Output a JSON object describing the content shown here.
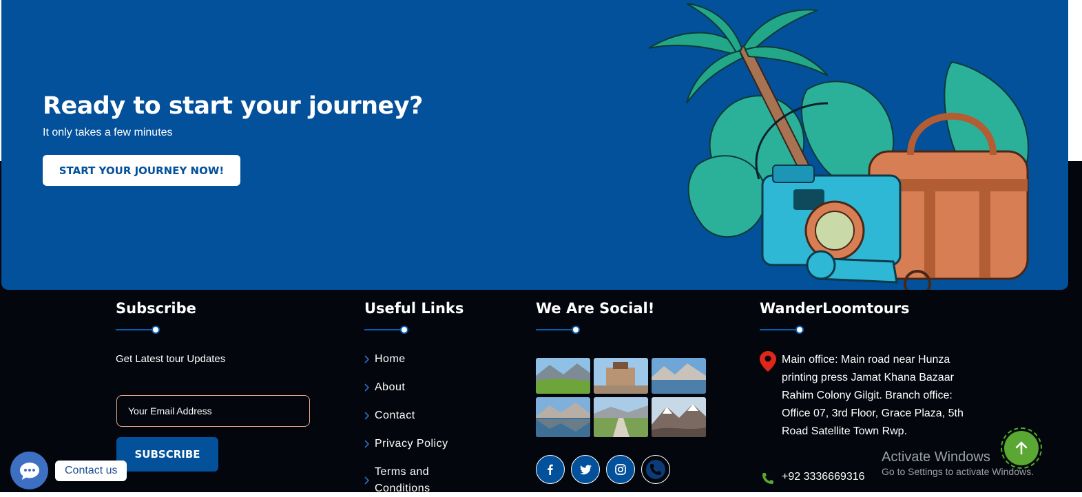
{
  "cta": {
    "title": "Ready to start your journey?",
    "subtitle": "It only takes a few minutes",
    "button": "START YOUR JOURNEY NOW!"
  },
  "subscribe": {
    "heading": "Subscribe",
    "text": "Get Latest tour Updates",
    "email_placeholder": "Your Email Address",
    "button": "SUBSCRIBE"
  },
  "useful_links": {
    "heading": "Useful Links",
    "items": [
      "Home",
      "About",
      "Contact",
      "Privacy Policy",
      "Terms and Conditions"
    ]
  },
  "social": {
    "heading": "We Are Social!",
    "gallery": [
      "valley-meadow-photo",
      "fort-photo",
      "lake-mountains-photo",
      "lake-reflection-photo",
      "road-valley-photo",
      "snowy-mountain-photo"
    ],
    "icons": [
      "facebook-icon",
      "twitter-icon",
      "instagram-icon",
      "phone-icon"
    ]
  },
  "company": {
    "heading": "WanderLoomtours",
    "address": "Main office: Main road near Hunza printing press Jamat Khana Bazaar Rahim Colony Gilgit. Branch office: Office 07, 3rd Floor, Grace Plaza, 5th Road Satellite Town Rwp.",
    "phone": "+92 3336669316"
  },
  "windows_watermark": {
    "line1": "Activate Windows",
    "line2": "Go to Settings to activate Windows."
  },
  "chat": {
    "label": "Contact us"
  },
  "colors": {
    "brand_blue": "#03509b",
    "footer_bg": "#04060d",
    "accent_green": "#5aa833",
    "pin_red": "#e0261b"
  }
}
